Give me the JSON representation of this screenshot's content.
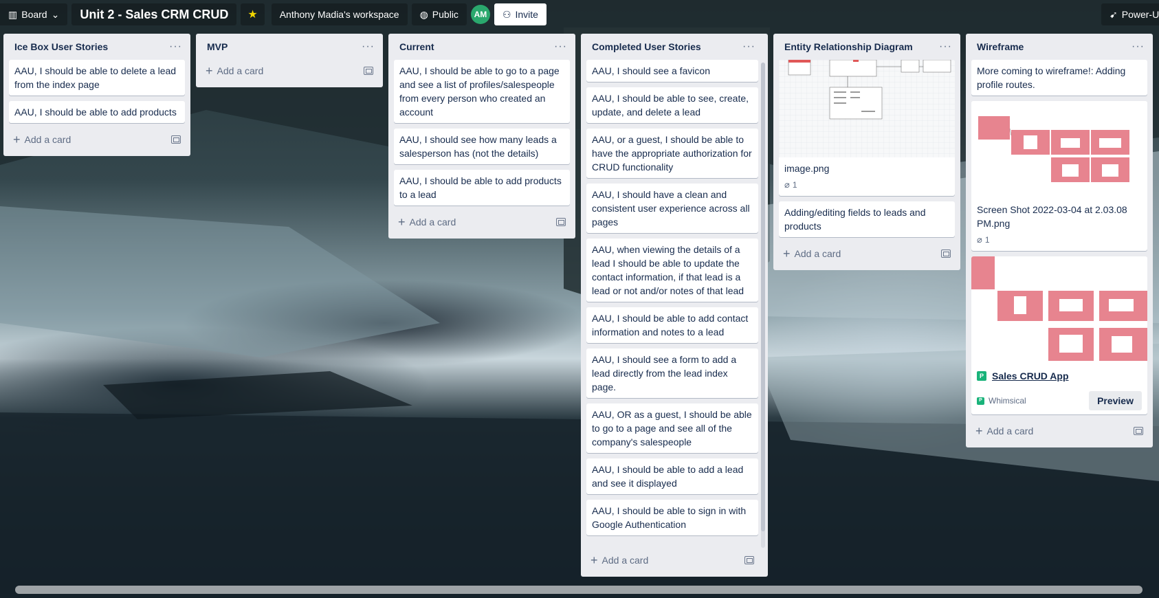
{
  "header": {
    "view_label": "Board",
    "board_title": "Unit 2 - Sales CRM CRUD",
    "workspace": "Anthony Madia's workspace",
    "visibility": "Public",
    "avatar_initials": "AM",
    "invite_label": "Invite",
    "powerups_label": "Power-Ups"
  },
  "add_card_label": "Add a card",
  "lists": {
    "icebox": {
      "title": "Ice Box User Stories",
      "cards": [
        "AAU, I should be able to delete a lead from the index page",
        "AAU, I should be able to add products"
      ]
    },
    "mvp": {
      "title": "MVP",
      "cards": []
    },
    "current": {
      "title": "Current",
      "cards": [
        "AAU, I should be able to go to a page and see a list of profiles/salespeople from every person who created an account",
        "AAU, I should see how many leads a salesperson has (not the details)",
        "AAU, I should be able to add products to a lead"
      ]
    },
    "completed": {
      "title": "Completed User Stories",
      "cards": [
        "AAU, I should see a favicon",
        "AAU, I should be able to see, create, update, and delete a lead",
        "AAU, or a guest, I should be able to have the appropriate authorization for CRUD functionality",
        "AAU, I should have a clean and consistent user experience across all pages",
        "AAU, when viewing the details of a lead I should be able to update the contact information, if that lead is a lead or not and/or notes of that lead",
        "AAU, I should be able to add contact information and notes to a lead",
        "AAU, I should see a form to add a lead directly from the lead index page.",
        "AAU, OR as a guest, I should be able to go to a page and see all of the company's salespeople",
        "AAU, I should be able to add a lead and see it displayed",
        "AAU, I should be able to sign in with Google Authentication"
      ]
    },
    "erd": {
      "title": "Entity Relationship Diagram",
      "cards": [
        {
          "title": "image.png",
          "attachments": "1"
        },
        {
          "title": "Adding/editing fields to leads and products"
        }
      ]
    },
    "wireframe": {
      "title": "Wireframe",
      "cards": [
        {
          "title": "More coming to wireframe!: Adding profile routes."
        },
        {
          "title": "Screen Shot 2022-03-04 at 2.03.08 PM.png",
          "attachments": "1"
        },
        {
          "title": "Sales CRUD App",
          "source": "Whimsical",
          "action": "Preview"
        }
      ]
    }
  }
}
